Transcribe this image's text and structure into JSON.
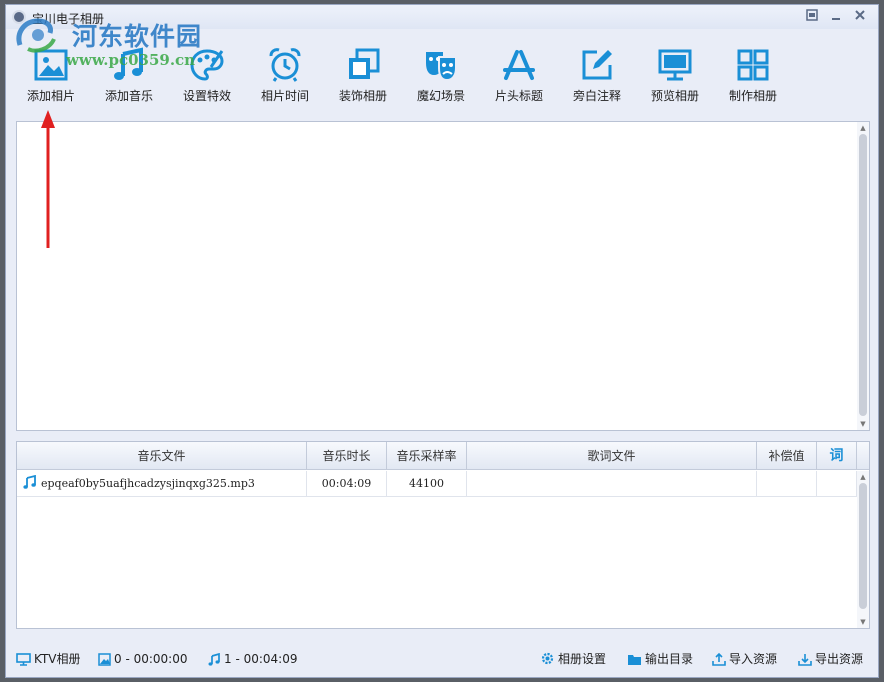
{
  "window": {
    "title": "宝川电子相册"
  },
  "watermark": {
    "title": "河东软件园",
    "url": "www.pc0359.cn"
  },
  "toolbar": {
    "items": [
      {
        "label": "添加相片",
        "icon": "image-icon"
      },
      {
        "label": "添加音乐",
        "icon": "music-note-icon"
      },
      {
        "label": "设置特效",
        "icon": "palette-icon"
      },
      {
        "label": "相片时间",
        "icon": "alarm-clock-icon"
      },
      {
        "label": "装饰相册",
        "icon": "stacked-frames-icon"
      },
      {
        "label": "魔幻场景",
        "icon": "theater-masks-icon"
      },
      {
        "label": "片头标题",
        "icon": "app-store-icon"
      },
      {
        "label": "旁白注释",
        "icon": "edit-note-icon"
      },
      {
        "label": "预览相册",
        "icon": "monitor-icon"
      },
      {
        "label": "制作相册",
        "icon": "grid-icon"
      }
    ]
  },
  "music_table": {
    "columns": [
      "音乐文件",
      "音乐时长",
      "音乐采样率",
      "歌词文件",
      "补偿值",
      "词"
    ],
    "rows": [
      {
        "file": "epqeaf0by5uafjhcadzysjinqxg325.mp3",
        "duration": "00:04:09",
        "sample_rate": "44100",
        "lyrics": "",
        "offset": ""
      }
    ]
  },
  "statusbar": {
    "ktv": "KTV相册",
    "photos": "0 - 00:00:00",
    "music": "1 - 00:04:09",
    "album_settings": "相册设置",
    "output_dir": "输出目录",
    "import": "导入资源",
    "export": "导出资源"
  },
  "colors": {
    "accent": "#1a8fd6",
    "background": "#e9edf7",
    "arrow": "#e02020"
  }
}
